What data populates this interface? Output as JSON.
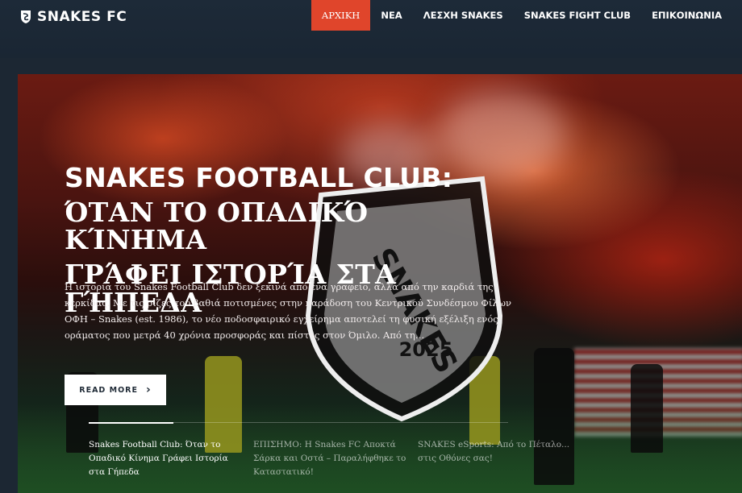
{
  "brand": {
    "name": "SNAKES FC",
    "logo_icon": "snake-shield-icon"
  },
  "nav": {
    "items": [
      {
        "label": "ΑΡΧΙΚΗ",
        "active": true
      },
      {
        "label": "ΝΕΑ",
        "active": false
      },
      {
        "label": "ΛΕΣΧΗ SNAKES",
        "active": false
      },
      {
        "label": "SNAKES FIGHT CLUB",
        "active": false
      },
      {
        "label": "ΕΠΙΚΟΙΝΩΝΙΑ",
        "active": false
      }
    ]
  },
  "hero": {
    "title_line1": "SNAKES FOOTBALL CLUB:",
    "title_line2": "ΌΤΑΝ ΤΟ ΟΠΑΔΙΚΌ ΚΊΝΗΜΑ",
    "title_line3": "ΓΡΆΦΕΙ ΙΣΤΟΡΊΑ ΣΤΑ ΓΉΠΕΔΑ",
    "excerpt": "Η ιστορία του Snakes Football Club δεν ξεκινά από ένα γραφείο, αλλά από την καρδιά της κερκίδας. Με τις ρίζες του βαθιά ποτισμένες στην παράδοση του Κεντρικού Συνδέσμου Φίλων ΟΦΗ – Snakes (est. 1986), το νέο ποδοσφαιρικό εγχείρημα αποτελεί τη φυσική εξέλιξη ενός οράματος που μετρά 40 χρόνια προσφοράς και πίστης στον Όμιλο. Από τη…",
    "read_more_label": "READ MORE",
    "read_more_icon": "chevron-right-icon",
    "crest_text_top": "SNAKES",
    "crest_text_year": "2025"
  },
  "slides": [
    {
      "label": "Snakes Football Club: Όταν το Οπαδικό Κίνημα Γράφει Ιστορία στα Γήπεδα",
      "active": true
    },
    {
      "label": "ΕΠΙΣΗΜΟ: Η Snakes FC Αποκτά Σάρκα και Οστά – Παραλήφθηκε το Καταστατικό!",
      "active": false
    },
    {
      "label": "SNAKES eSports: Από το Πέταλο... στις Οθόνες σας!",
      "active": false
    }
  ],
  "colors": {
    "accent": "#e0452b",
    "header_bg": "#1d2a38"
  }
}
